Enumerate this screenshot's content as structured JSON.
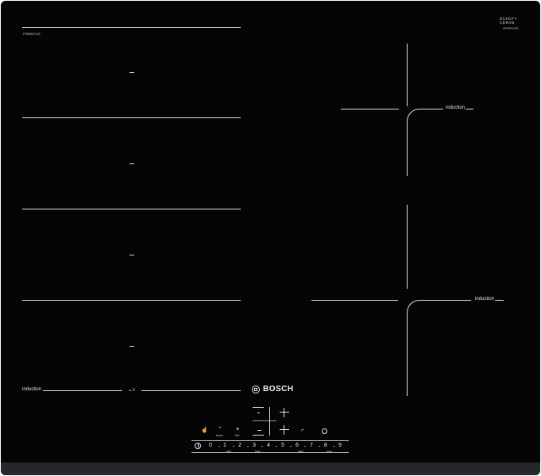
{
  "hob": {
    "model_code": "PXE651FC1E",
    "brand_logo": {
      "line1": "SCHOTT",
      "line2": "CERAN",
      "sub": "APPROVED"
    },
    "brand": "BOSCH",
    "zones": {
      "left_label": "induction",
      "right_top_label": "induction",
      "right_bottom_label": "induction",
      "flex_symbol": "ᴗ⊃"
    },
    "controls": {
      "buttons": [
        {
          "icon": "hand-icon",
          "label": ""
        },
        {
          "icon": "boost-icon",
          "label": "boost"
        },
        {
          "icon": "flex-icon",
          "label": "flex"
        }
      ],
      "scale": [
        "0",
        "1",
        "2",
        "3",
        "4",
        "5",
        "6",
        "7",
        "8",
        "9"
      ],
      "scale_sublabels": [
        "min",
        "max",
        "max",
        "max"
      ]
    },
    "colors": {
      "surface": "#050506",
      "frame": "#26272b",
      "markings": "#dfe0e2"
    }
  }
}
